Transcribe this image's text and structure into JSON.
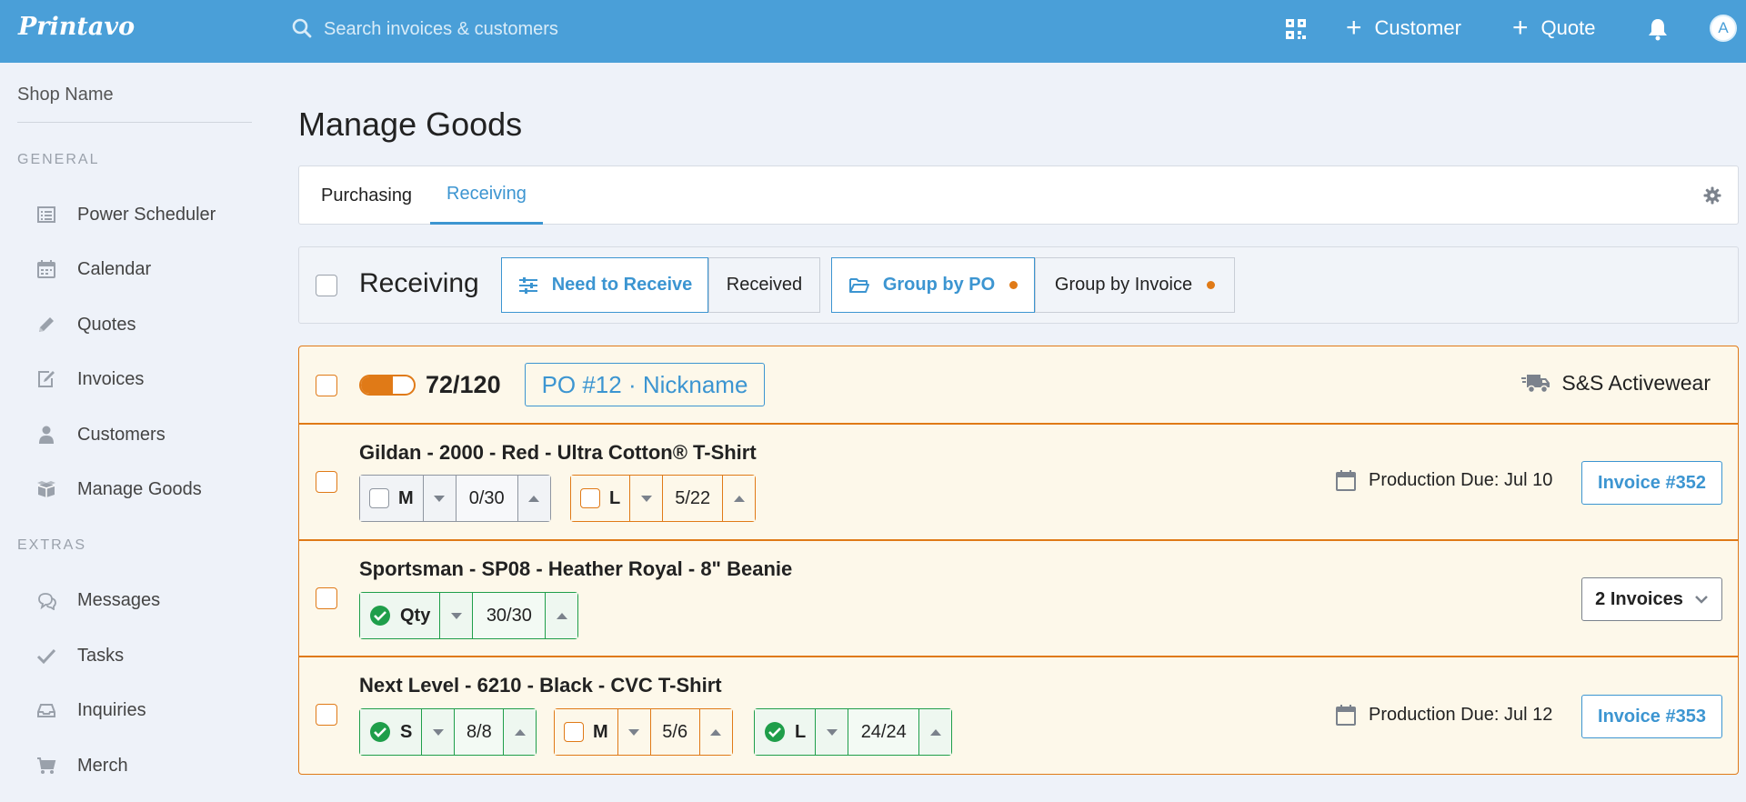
{
  "app": {
    "logo": "Printavo"
  },
  "search": {
    "placeholder": "Search invoices & customers"
  },
  "header": {
    "customer_label": "Customer",
    "quote_label": "Quote",
    "avatar_initial": "A"
  },
  "sidebar": {
    "shop_name": "Shop Name",
    "general_label": "GENERAL",
    "extras_label": "EXTRAS",
    "general_items": [
      {
        "label": "Power Scheduler",
        "icon": "list-icon"
      },
      {
        "label": "Calendar",
        "icon": "calendar-icon"
      },
      {
        "label": "Quotes",
        "icon": "pencil-icon"
      },
      {
        "label": "Invoices",
        "icon": "edit-icon"
      },
      {
        "label": "Customers",
        "icon": "user-icon"
      },
      {
        "label": "Manage Goods",
        "icon": "box-icon"
      }
    ],
    "extras_items": [
      {
        "label": "Messages",
        "icon": "chat-icon"
      },
      {
        "label": "Tasks",
        "icon": "check-icon"
      },
      {
        "label": "Inquiries",
        "icon": "inbox-icon"
      },
      {
        "label": "Merch",
        "icon": "cart-icon"
      }
    ]
  },
  "page": {
    "title": "Manage Goods"
  },
  "tabs": [
    {
      "label": "Purchasing",
      "active": false
    },
    {
      "label": "Receiving",
      "active": true
    }
  ],
  "filter": {
    "title": "Receiving",
    "need_to_receive": "Need to Receive",
    "received": "Received",
    "group_by_po": "Group by PO",
    "group_by_invoice": "Group by Invoice"
  },
  "po": {
    "received": 72,
    "total": 120,
    "progress_text": "72/120",
    "badge": "PO #12 · Nickname",
    "vendor": "S&S Activewear",
    "items": [
      {
        "title": "Gildan - 2000 - Red - Ultra Cotton® T-Shirt",
        "sizes": [
          {
            "label": "M",
            "value": "0/30",
            "state": "empty"
          },
          {
            "label": "L",
            "value": "5/22",
            "state": "partial"
          }
        ],
        "due": "Production Due: Jul 10",
        "invoice": "Invoice #352"
      },
      {
        "title": "Sportsman - SP08 - Heather Royal - 8\" Beanie",
        "sizes": [
          {
            "label": "Qty",
            "value": "30/30",
            "state": "complete"
          }
        ],
        "invoices_dropdown": "2 Invoices"
      },
      {
        "title": "Next Level - 6210 - Black - CVC T-Shirt",
        "sizes": [
          {
            "label": "S",
            "value": "8/8",
            "state": "complete"
          },
          {
            "label": "M",
            "value": "5/6",
            "state": "partial"
          },
          {
            "label": "L",
            "value": "24/24",
            "state": "complete"
          }
        ],
        "due": "Production Due: Jul 12",
        "invoice": "Invoice #353"
      }
    ]
  },
  "colors": {
    "header": "#4a9fd8",
    "accent": "#3c95d1",
    "warning": "#e07a17",
    "success": "#1f9e4a"
  }
}
